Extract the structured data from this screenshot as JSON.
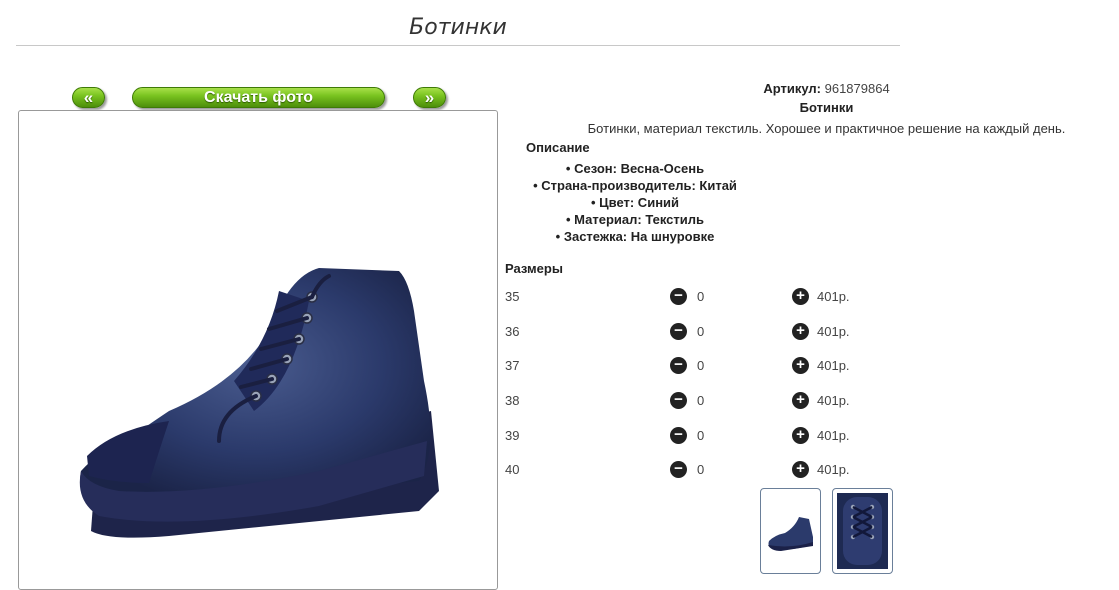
{
  "page": {
    "title": "Ботинки"
  },
  "gallery": {
    "prev_label": "«",
    "download_label": "Скачать фото",
    "next_label": "»"
  },
  "product": {
    "sku_label": "Артикул:",
    "sku_value": "961879864",
    "name": "Ботинки",
    "short_description": "Ботинки, материал текстиль. Хорошее и практичное решение на каждый день.",
    "description_heading": "Описание",
    "specs": [
      "Сезон: Весна-Осень",
      "Страна-производитель: Китай",
      "Цвет: Синий",
      "Материал: Текстиль",
      "Застежка: На шнуровке"
    ],
    "sizes_heading": "Размеры",
    "sizes": [
      {
        "size": "35",
        "qty": "0",
        "price": "401р."
      },
      {
        "size": "36",
        "qty": "0",
        "price": "401р."
      },
      {
        "size": "37",
        "qty": "0",
        "price": "401р."
      },
      {
        "size": "38",
        "qty": "0",
        "price": "401р."
      },
      {
        "size": "39",
        "qty": "0",
        "price": "401р."
      },
      {
        "size": "40",
        "qty": "0",
        "price": "401р."
      }
    ]
  },
  "icons": {
    "decrement": "minus-circle-icon",
    "increment": "plus-circle-icon"
  },
  "colors": {
    "button_green": "#7ac420",
    "shoe_denim": "#2b3a6b"
  }
}
